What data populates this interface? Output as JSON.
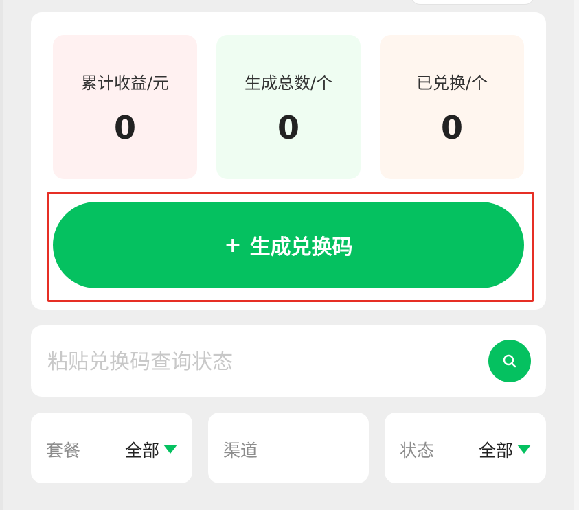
{
  "stats": [
    {
      "label": "累计收益/元",
      "value": "0"
    },
    {
      "label": "生成总数/个",
      "value": "0"
    },
    {
      "label": "已兑换/个",
      "value": "0"
    }
  ],
  "generate_button": {
    "icon": "+",
    "label": "生成兑换码"
  },
  "search": {
    "placeholder": "粘贴兑换码查询状态",
    "value": "",
    "icon": "search-icon"
  },
  "filters": {
    "package": {
      "label": "套餐",
      "value": "全部"
    },
    "channel": {
      "label": "渠道"
    },
    "status": {
      "label": "状态",
      "value": "全部"
    }
  },
  "colors": {
    "accent": "#05c160",
    "highlight_frame": "#e62f25",
    "page_background": "#eeeeee",
    "card_background": "#ffffff"
  }
}
